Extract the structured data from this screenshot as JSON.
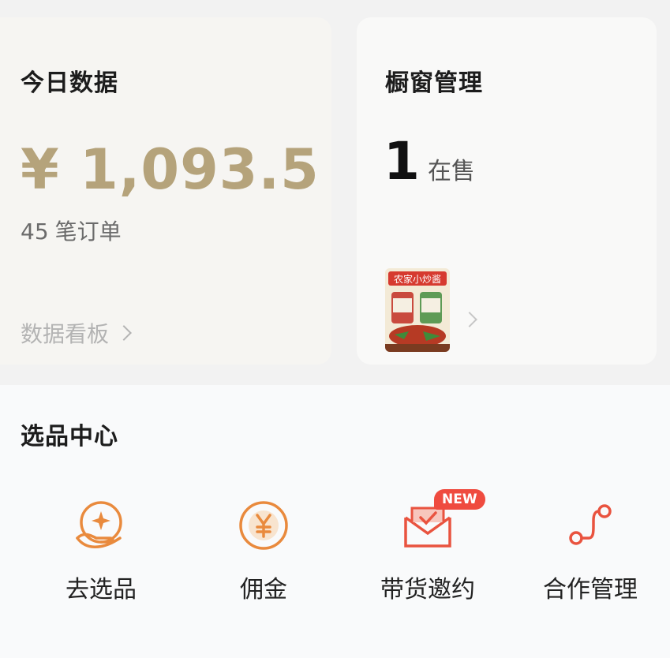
{
  "today": {
    "title": "今日数据",
    "amount": "¥ 1,093.5",
    "orders_count": "45",
    "orders_label": "笔订单",
    "board_link": "数据看板"
  },
  "window": {
    "title": "橱窗管理",
    "count": "1",
    "count_label": "在售",
    "product_text": "农家小炒酱"
  },
  "picks": {
    "title": "选品中心",
    "entries": [
      {
        "label": "去选品",
        "icon": "hand-star-icon"
      },
      {
        "label": "佣金",
        "icon": "yen-circle-icon"
      },
      {
        "label": "带货邀约",
        "icon": "envelope-check-icon",
        "badge": "NEW"
      },
      {
        "label": "合作管理",
        "icon": "route-icon"
      }
    ]
  },
  "colors": {
    "amount": "#b5a37b",
    "accent": "#e98a3d",
    "badge": "#ef4b3f"
  }
}
